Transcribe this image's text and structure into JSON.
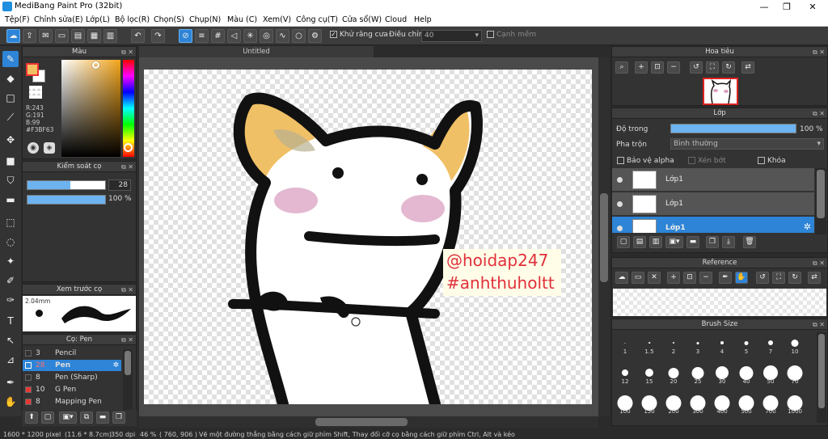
{
  "app": {
    "title": "MediBang Paint Pro (32bit)"
  },
  "window": {
    "minimize": "—",
    "restore": "❐",
    "close": "✕"
  },
  "menu": [
    "Tệp(F)",
    "Chỉnh sửa(E)",
    "Lớp(L)",
    "Bộ lọc(R)",
    "Chọn(S)",
    "Chụp(N)",
    "Màu (C)",
    "Xem(V)",
    "Công cụ(T)",
    "Cửa sổ(W)",
    "Cloud",
    "Help"
  ],
  "toolbar": {
    "antialias_label": "Khử răng cưa",
    "adjust_label": "Điều chỉnh",
    "adjust_value": "40",
    "snap_label": "Cạnh mềm"
  },
  "color_panel": {
    "title": "Màu",
    "r": "R:243",
    "g": "G:191",
    "b": "B:99",
    "hex": "#F3BF63",
    "primary": "#F3BF63"
  },
  "brush_control": {
    "title": "Kiểm soát cọ",
    "size": "28",
    "opacity": "100 %",
    "size_fraction": 0.55,
    "opacity_fraction": 1.0
  },
  "brush_preview": {
    "title": "Xem trước cọ",
    "size_text": "2.04mm"
  },
  "brush_list": {
    "title": "Cọ: Pen",
    "items": [
      {
        "num": "3",
        "name": "Pencil",
        "color": "#333333"
      },
      {
        "num": "28",
        "name": "Pen",
        "color": "#2e84d6",
        "active": true
      },
      {
        "num": "8",
        "name": "Pen (Sharp)",
        "color": "#333333"
      },
      {
        "num": "10",
        "name": "G Pen",
        "color": "#e53935"
      },
      {
        "num": "8",
        "name": "Mapping Pen",
        "color": "#e53935"
      }
    ]
  },
  "document": {
    "tab": "Untitled"
  },
  "watermark": {
    "line1": "@hoidap247",
    "line2": "#anhthuholtt"
  },
  "navigator": {
    "title": "Hoa tiêu"
  },
  "layer_panel": {
    "title": "Lớp",
    "opacity_label": "Độ trong",
    "opacity_value": "100 %",
    "blend_label": "Pha trộn",
    "blend_value": "Bình thường",
    "protect_alpha": "Bảo vệ alpha",
    "clipping": "Xén bớt",
    "lock": "Khóa",
    "layers": [
      {
        "name": "Lớp1"
      },
      {
        "name": "Lớp1"
      },
      {
        "name": "Lớp1",
        "active": true
      }
    ]
  },
  "reference": {
    "title": "Reference"
  },
  "brush_size": {
    "title": "Brush Size",
    "sizes": [
      "1",
      "1.5",
      "2",
      "3",
      "4",
      "5",
      "7",
      "10",
      "12",
      "15",
      "20",
      "25",
      "30",
      "40",
      "50",
      "70",
      "100",
      "150",
      "200",
      "300",
      "400",
      "500",
      "700",
      "1000"
    ]
  },
  "status": {
    "dimensions": "1600 * 1200 pixel",
    "physical": "(11.6 * 8.7cm)",
    "dpi": "350 dpi",
    "zoom": "46 %",
    "coords": "( 760, 906 )",
    "hint": "Vẽ một đường thẳng bằng cách giữ phím Shift, Thay đổi cỡ cọ bằng cách giữ phím Ctrl, Alt và kéo"
  }
}
